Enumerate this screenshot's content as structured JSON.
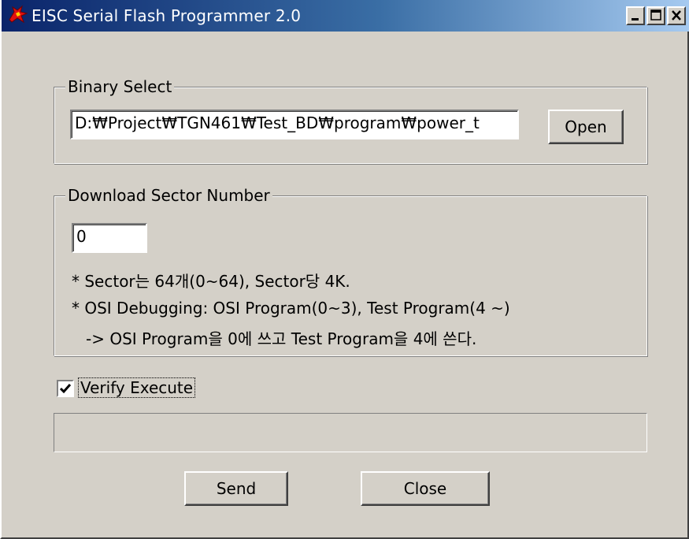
{
  "window": {
    "title": "EISC Serial Flash Programmer 2.0"
  },
  "binary_select": {
    "label": "Binary Select",
    "path_value": "D:₩Project₩TGN461₩Test_BD₩program₩power_t",
    "open_label": "Open"
  },
  "download_sector": {
    "label": "Download Sector Number",
    "sector_value": "0",
    "note1": "* Sector는 64개(0~64), Sector당 4K.",
    "note2": "* OSI Debugging: OSI Program(0~3), Test Program(4 ~)",
    "note3": "-> OSI Program을 0에 쓰고 Test Program을 4에 쓴다."
  },
  "verify": {
    "label": "Verify Execute",
    "checked": true
  },
  "progress": {
    "value": 0
  },
  "buttons": {
    "send_label": "Send",
    "close_label": "Close"
  },
  "colors": {
    "dialog_bg": "#d4d0c8",
    "title_start": "#0a246a",
    "title_end": "#a6caf0"
  }
}
